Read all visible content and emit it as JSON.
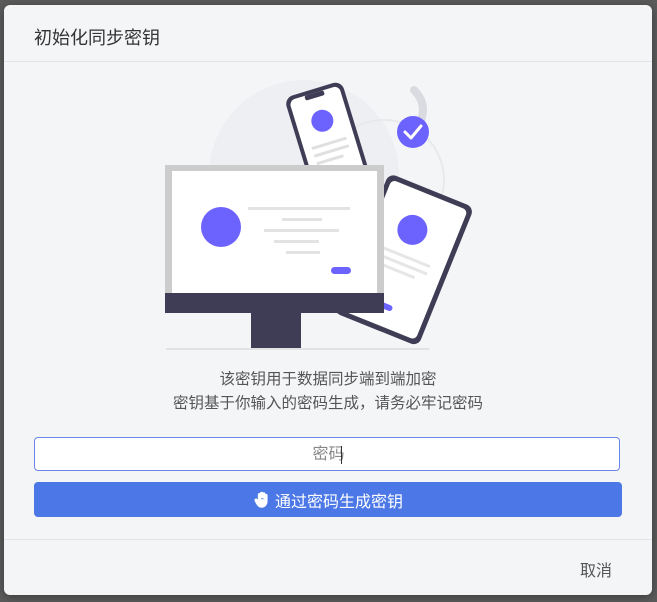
{
  "dialog": {
    "title": "初始化同步密钥",
    "description_line1": "该密钥用于数据同步端到端加密",
    "description_line2": "密钥基于你输入的密码生成，请务必牢记密码",
    "password_placeholder": "密码",
    "generate_button_label": "通过密码生成密钥",
    "cancel_label": "取消",
    "generate_button_icon": "hand-icon"
  },
  "colors": {
    "accent": "#4b78e6",
    "illustration_purple": "#6c63ff",
    "dark": "#3f3d56"
  }
}
